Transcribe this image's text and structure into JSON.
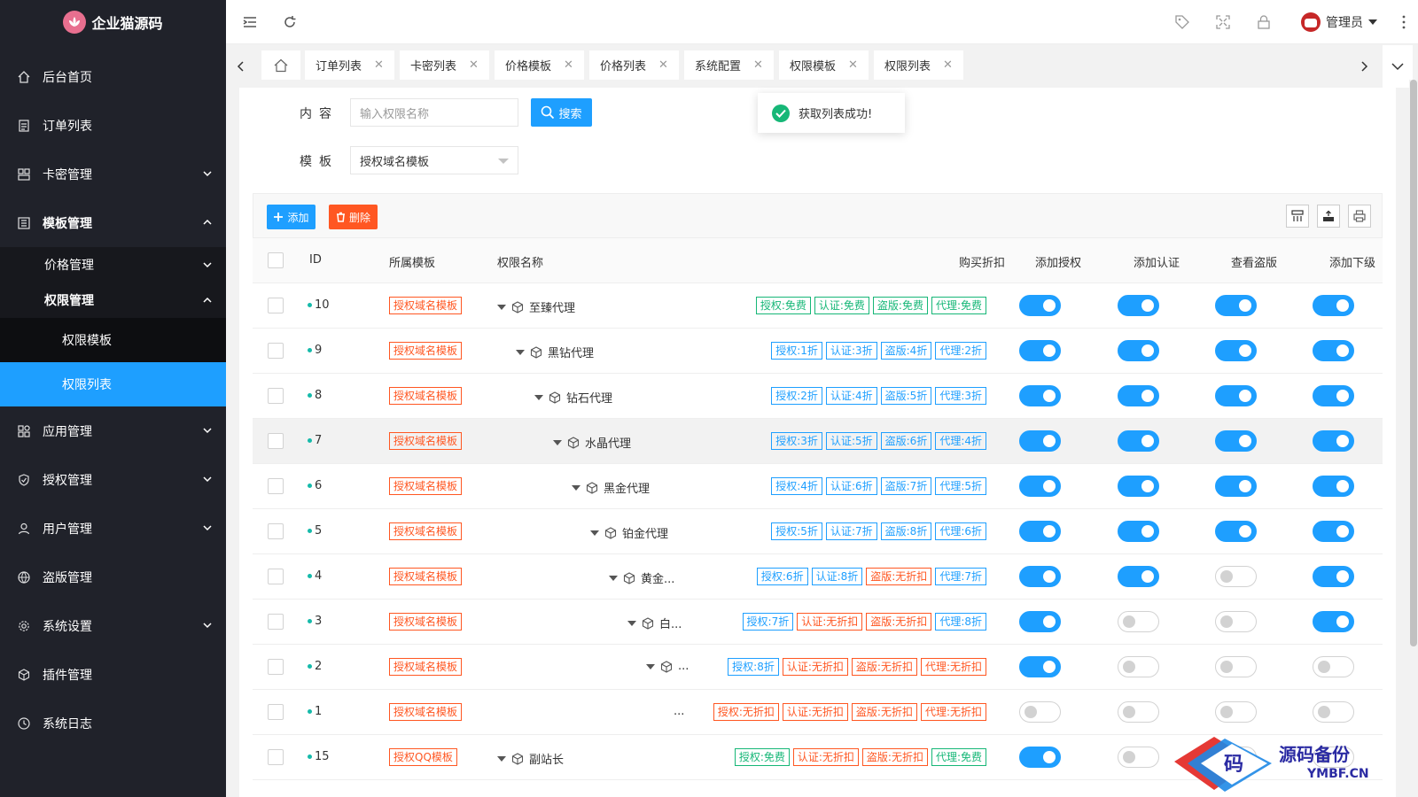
{
  "app": {
    "title": "企业猫源码"
  },
  "sidebar": {
    "items": [
      {
        "label": "后台首页",
        "icon": "home-icon"
      },
      {
        "label": "订单列表",
        "icon": "list-icon"
      },
      {
        "label": "卡密管理",
        "icon": "grid-icon"
      },
      {
        "label": "模板管理",
        "icon": "template-icon"
      },
      {
        "label": "应用管理",
        "icon": "app-icon"
      },
      {
        "label": "授权管理",
        "icon": "shield-icon"
      },
      {
        "label": "用户管理",
        "icon": "user-icon"
      },
      {
        "label": "盗版管理",
        "icon": "globe-icon"
      },
      {
        "label": "系统设置",
        "icon": "gear-icon"
      },
      {
        "label": "插件管理",
        "icon": "plugin-icon"
      },
      {
        "label": "系统日志",
        "icon": "clock-icon"
      }
    ],
    "sub_items": [
      {
        "label": "价格管理"
      },
      {
        "label": "权限管理"
      }
    ],
    "subsub_items": [
      {
        "label": "权限模板"
      },
      {
        "label": "权限列表"
      }
    ]
  },
  "header": {
    "admin_label": "管理员"
  },
  "tabs": [
    {
      "label": "订单列表"
    },
    {
      "label": "卡密列表"
    },
    {
      "label": "价格模板"
    },
    {
      "label": "价格列表"
    },
    {
      "label": "系统配置"
    },
    {
      "label": "权限模板"
    },
    {
      "label": "权限列表"
    }
  ],
  "search": {
    "content_label": "内容",
    "placeholder": "输入权限名称",
    "button": "搜索",
    "template_label": "模板",
    "template_value": "授权域名模板"
  },
  "toast": {
    "message": "获取列表成功!"
  },
  "toolbar": {
    "add": "添加",
    "delete": "删除"
  },
  "table": {
    "columns": [
      "ID",
      "所属模板",
      "权限名称",
      "购买折扣",
      "添加授权",
      "添加认证",
      "查看盗版",
      "添加下级"
    ],
    "rows": [
      {
        "id": "10",
        "template": "授权域名模板",
        "name": "至臻代理",
        "tags": [
          {
            "t": "授权:免费",
            "c": "green"
          },
          {
            "t": "认证:免费",
            "c": "green"
          },
          {
            "t": "盗版:免费",
            "c": "green"
          },
          {
            "t": "代理:免费",
            "c": "green"
          }
        ],
        "switches": [
          true,
          true,
          true,
          true
        ]
      },
      {
        "id": "9",
        "template": "授权域名模板",
        "name": "黑钻代理",
        "tags": [
          {
            "t": "授权:1折",
            "c": "blue"
          },
          {
            "t": "认证:3折",
            "c": "blue"
          },
          {
            "t": "盗版:4折",
            "c": "blue"
          },
          {
            "t": "代理:2折",
            "c": "blue"
          }
        ],
        "switches": [
          true,
          true,
          true,
          true
        ]
      },
      {
        "id": "8",
        "template": "授权域名模板",
        "name": "钻石代理",
        "tags": [
          {
            "t": "授权:2折",
            "c": "blue"
          },
          {
            "t": "认证:4折",
            "c": "blue"
          },
          {
            "t": "盗版:5折",
            "c": "blue"
          },
          {
            "t": "代理:3折",
            "c": "blue"
          }
        ],
        "switches": [
          true,
          true,
          true,
          true
        ]
      },
      {
        "id": "7",
        "template": "授权域名模板",
        "name": "水晶代理",
        "tags": [
          {
            "t": "授权:3折",
            "c": "blue"
          },
          {
            "t": "认证:5折",
            "c": "blue"
          },
          {
            "t": "盗版:6折",
            "c": "blue"
          },
          {
            "t": "代理:4折",
            "c": "blue"
          }
        ],
        "switches": [
          true,
          true,
          true,
          true
        ]
      },
      {
        "id": "6",
        "template": "授权域名模板",
        "name": "黑金代理",
        "tags": [
          {
            "t": "授权:4折",
            "c": "blue"
          },
          {
            "t": "认证:6折",
            "c": "blue"
          },
          {
            "t": "盗版:7折",
            "c": "blue"
          },
          {
            "t": "代理:5折",
            "c": "blue"
          }
        ],
        "switches": [
          true,
          true,
          true,
          true
        ]
      },
      {
        "id": "5",
        "template": "授权域名模板",
        "name": "铂金代理",
        "tags": [
          {
            "t": "授权:5折",
            "c": "blue"
          },
          {
            "t": "认证:7折",
            "c": "blue"
          },
          {
            "t": "盗版:8折",
            "c": "blue"
          },
          {
            "t": "代理:6折",
            "c": "blue"
          }
        ],
        "switches": [
          true,
          true,
          true,
          true
        ]
      },
      {
        "id": "4",
        "template": "授权域名模板",
        "name": "黄金...",
        "tags": [
          {
            "t": "授权:6折",
            "c": "blue"
          },
          {
            "t": "认证:8折",
            "c": "blue"
          },
          {
            "t": "盗版:无折扣",
            "c": "red"
          },
          {
            "t": "代理:7折",
            "c": "blue"
          }
        ],
        "switches": [
          true,
          true,
          false,
          true
        ]
      },
      {
        "id": "3",
        "template": "授权域名模板",
        "name": "白...",
        "tags": [
          {
            "t": "授权:7折",
            "c": "blue"
          },
          {
            "t": "认证:无折扣",
            "c": "red"
          },
          {
            "t": "盗版:无折扣",
            "c": "red"
          },
          {
            "t": "代理:8折",
            "c": "blue"
          }
        ],
        "switches": [
          true,
          false,
          false,
          true
        ]
      },
      {
        "id": "2",
        "template": "授权域名模板",
        "name": "...",
        "tags": [
          {
            "t": "授权:8折",
            "c": "blue"
          },
          {
            "t": "认证:无折扣",
            "c": "red"
          },
          {
            "t": "盗版:无折扣",
            "c": "red"
          },
          {
            "t": "代理:无折扣",
            "c": "red"
          }
        ],
        "switches": [
          true,
          false,
          false,
          false
        ]
      },
      {
        "id": "1",
        "template": "授权域名模板",
        "name": "...",
        "tags": [
          {
            "t": "授权:无折扣",
            "c": "red"
          },
          {
            "t": "认证:无折扣",
            "c": "red"
          },
          {
            "t": "盗版:无折扣",
            "c": "red"
          },
          {
            "t": "代理:无折扣",
            "c": "red"
          }
        ],
        "switches": [
          false,
          false,
          false,
          false
        ]
      },
      {
        "id": "15",
        "template": "授权QQ模板",
        "name": "副站长",
        "tags": [
          {
            "t": "授权:免费",
            "c": "green"
          },
          {
            "t": "认证:无折扣",
            "c": "red"
          },
          {
            "t": "盗版:无折扣",
            "c": "red"
          },
          {
            "t": "代理:免费",
            "c": "green"
          }
        ],
        "switches": [
          true,
          false,
          false,
          false
        ]
      }
    ]
  },
  "watermark": {
    "text": "源码备份",
    "url": "YMBF.CN",
    "logo_char": "码"
  },
  "colors": {
    "sidebar_bg": "#20222a",
    "active": "#1e9fff",
    "danger": "#ff5722",
    "success": "#16b777"
  }
}
